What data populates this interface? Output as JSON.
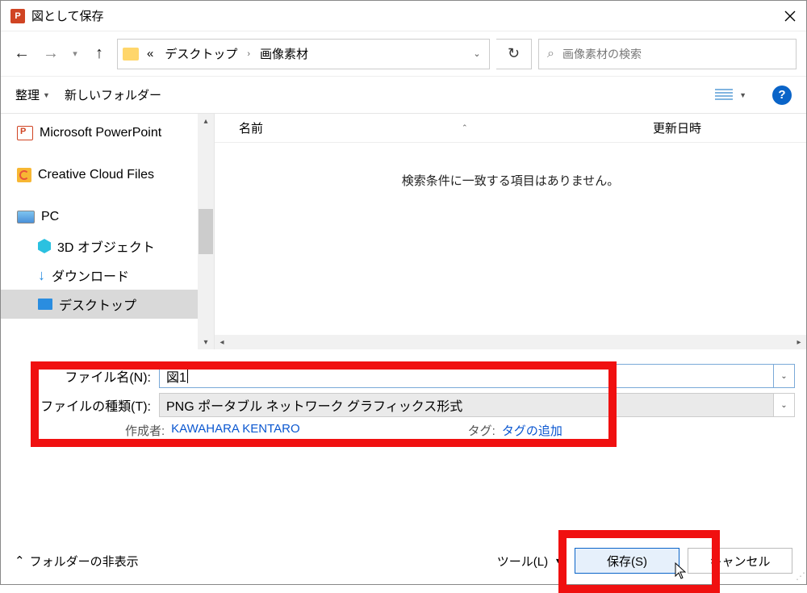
{
  "titlebar": {
    "app_icon_letter": "P",
    "title": "図として保存"
  },
  "nav": {
    "crumb_prefix": "«",
    "crumb1": "デスクトップ",
    "crumb2": "画像素材",
    "search_placeholder": "画像素材の検索"
  },
  "toolbar": {
    "organize": "整理",
    "new_folder": "新しいフォルダー"
  },
  "sidebar": {
    "items": [
      {
        "label": "Microsoft PowerPoint",
        "icon": "pp"
      },
      {
        "label": "Creative Cloud Files",
        "icon": "cc"
      },
      {
        "label": "PC",
        "icon": "pc"
      },
      {
        "label": "3D オブジェクト",
        "icon": "3d",
        "sub": true
      },
      {
        "label": "ダウンロード",
        "icon": "dl",
        "sub": true
      },
      {
        "label": "デスクトップ",
        "icon": "desk",
        "sub": true,
        "selected": true
      }
    ]
  },
  "columns": {
    "name": "名前",
    "date": "更新日時"
  },
  "main": {
    "empty_message": "検索条件に一致する項目はありません。"
  },
  "fields": {
    "filename_label": "ファイル名(N):",
    "filename_value": "図1",
    "filetype_label": "ファイルの種類(T):",
    "filetype_value": "PNG ポータブル ネットワーク グラフィックス形式",
    "author_label": "作成者:",
    "author_value": "KAWAHARA KENTARO",
    "tag_label": "タグ:",
    "tag_value": "タグの追加"
  },
  "bottom": {
    "hide_folders": "フォルダーの非表示",
    "tools": "ツール(L)",
    "save": "保存(S)",
    "cancel": "キャンセル"
  }
}
